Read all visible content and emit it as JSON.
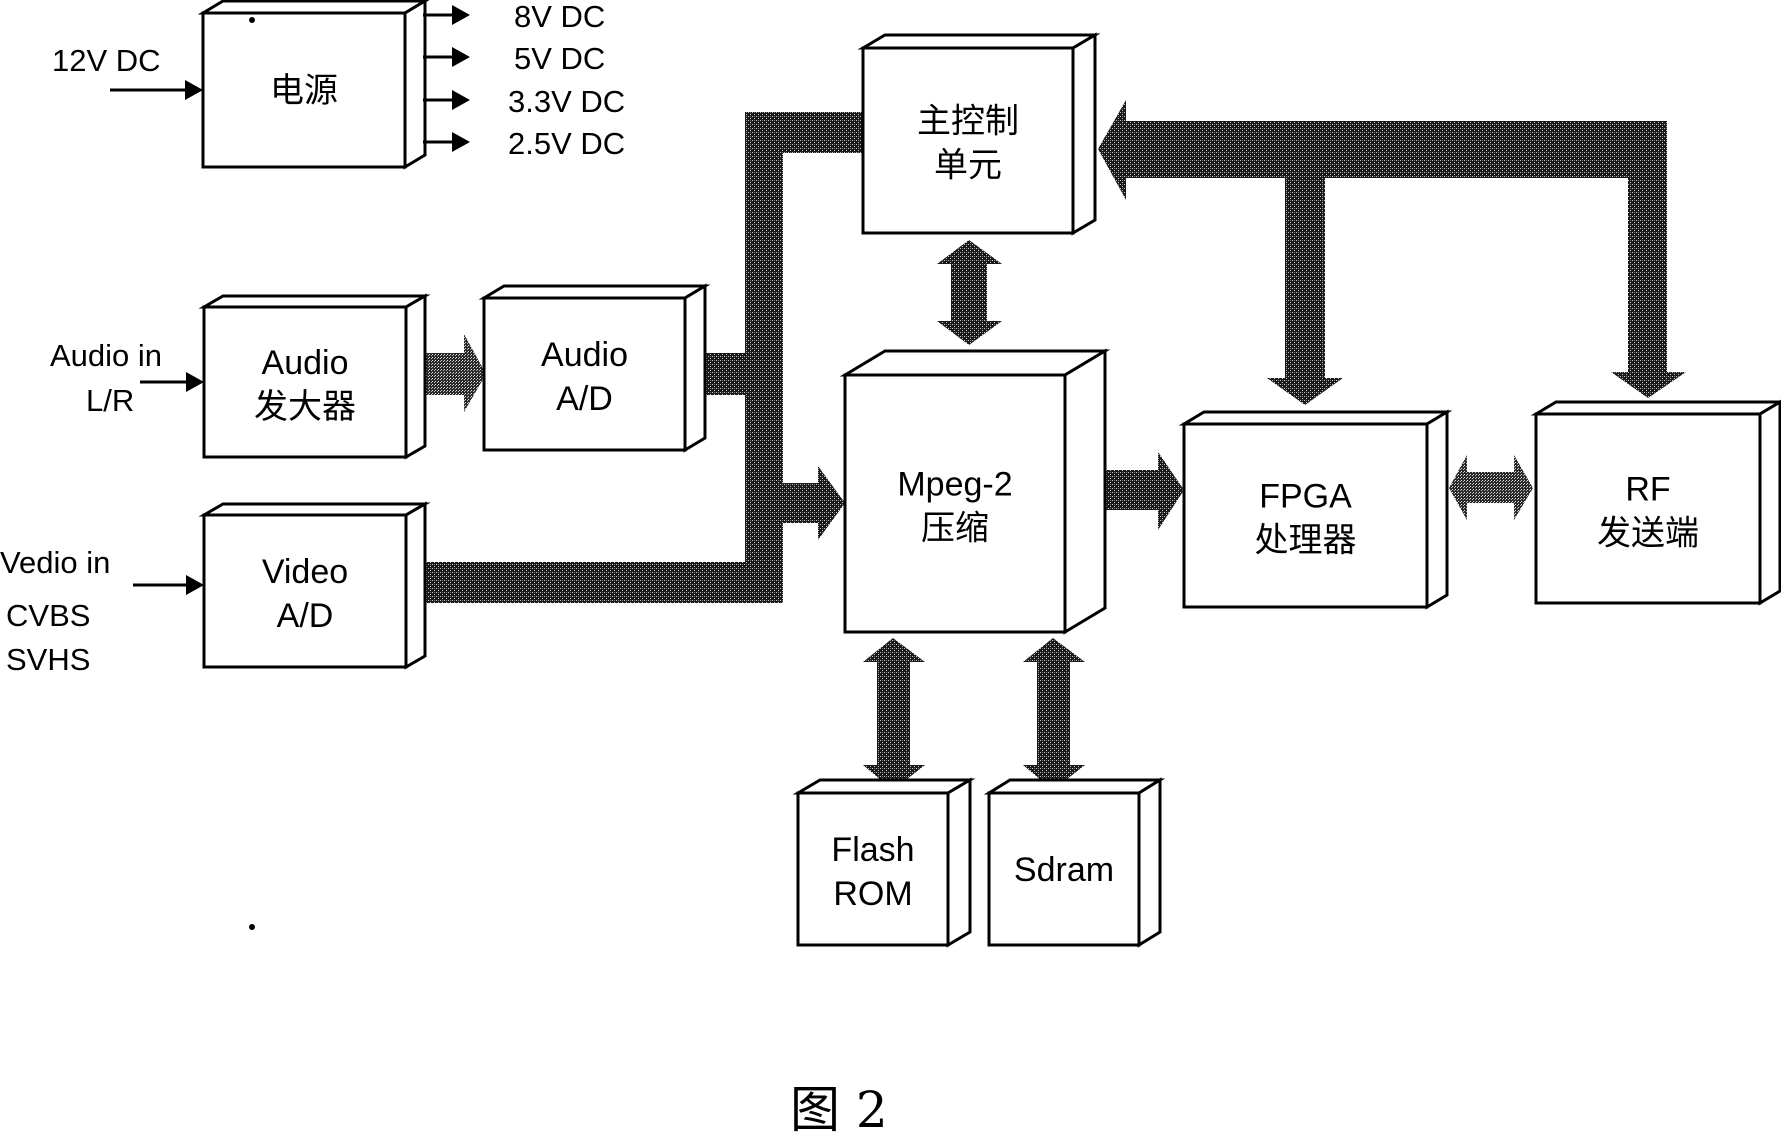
{
  "figure": {
    "caption": "图 2",
    "colors": {
      "ink": "#000000",
      "background": "#ffffff",
      "bus_fill": "#1a1a1a",
      "bus_dither": "#9a9a9a"
    }
  },
  "blocks": {
    "power": {
      "line1": "电源",
      "line2": ""
    },
    "main_control": {
      "line1": "主控制",
      "line2": "单元"
    },
    "audio_amp": {
      "line1": "Audio",
      "line2": "发大器"
    },
    "audio_ad": {
      "line1": "Audio",
      "line2": "A/D"
    },
    "video_ad": {
      "line1": "Video",
      "line2": "A/D"
    },
    "mpeg2": {
      "line1": "Mpeg-2",
      "line2": "压缩"
    },
    "fpga": {
      "line1": "FPGA",
      "line2": "处理器"
    },
    "rf": {
      "line1": "RF",
      "line2": "发送端"
    },
    "flash_rom": {
      "line1": "Flash",
      "line2": "ROM"
    },
    "sdram": {
      "line1": "Sdram",
      "line2": ""
    }
  },
  "inputs": {
    "power_in": "12V DC",
    "audio_in": {
      "line1": "Audio in",
      "line2": "L/R"
    },
    "video_in": {
      "line1": "Vedio in",
      "line2": "CVBS",
      "line3": "SVHS"
    }
  },
  "power_outputs": [
    "8V DC",
    "5V DC",
    "3.3V DC",
    "2.5V DC"
  ],
  "connections": [
    {
      "from": "audio_amp",
      "to": "audio_ad",
      "type": "arrow"
    },
    {
      "from": "audio_ad",
      "to": "mpeg2",
      "type": "bus"
    },
    {
      "from": "video_ad",
      "to": "mpeg2",
      "type": "bus"
    },
    {
      "from": "main_control",
      "to": "mpeg2",
      "type": "bidirectional"
    },
    {
      "from": "mpeg2",
      "to": "fpga",
      "type": "arrow"
    },
    {
      "from": "fpga",
      "to": "rf",
      "type": "bidirectional"
    },
    {
      "from": "mpeg2",
      "to": "flash_rom",
      "type": "bidirectional"
    },
    {
      "from": "mpeg2",
      "to": "sdram",
      "type": "bidirectional"
    },
    {
      "from": "fpga",
      "to": "main_control",
      "type": "bus"
    },
    {
      "from": "rf",
      "to": "main_control",
      "type": "bus"
    }
  ]
}
